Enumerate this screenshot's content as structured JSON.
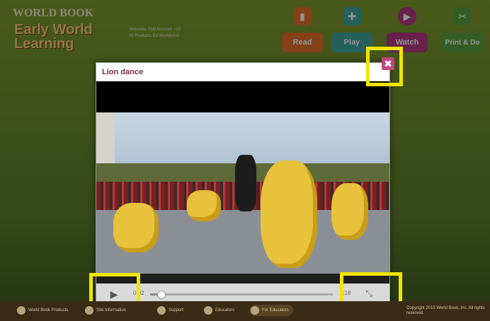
{
  "brand": {
    "top": "WORLD BOOK",
    "title_line1": "Early World",
    "title_line2": "Learning"
  },
  "welcome": {
    "line1": "Welcome Trial Account - Int",
    "line2": "All Products Ed Worldwind"
  },
  "nav": [
    {
      "label": "Read",
      "icon": "book-icon",
      "color": "#e2702c"
    },
    {
      "label": "Play",
      "icon": "gamepad-icon",
      "color": "#3fa7a0"
    },
    {
      "label": "Watch",
      "icon": "play-circle-icon",
      "color": "#b23a82"
    },
    {
      "label": "Print & Do",
      "icon": "scissors-icon",
      "color": "#5aa040"
    }
  ],
  "modal": {
    "title": "Lion dance",
    "close_glyph": "✖",
    "player": {
      "play_glyph": "▶",
      "time_current": "0:02",
      "time_duration": "0:18",
      "progress": 0.06,
      "fullscreen_glyph": "⤡"
    }
  },
  "footer": [
    {
      "label": "World Book Products"
    },
    {
      "label": "Site Information"
    },
    {
      "label": "Support"
    },
    {
      "label": "Educators"
    },
    {
      "label": "For Educators"
    },
    {
      "label": "Copyright 2015 World Book, Inc. All rights reserved."
    }
  ],
  "highlight_color": "#f0e500"
}
